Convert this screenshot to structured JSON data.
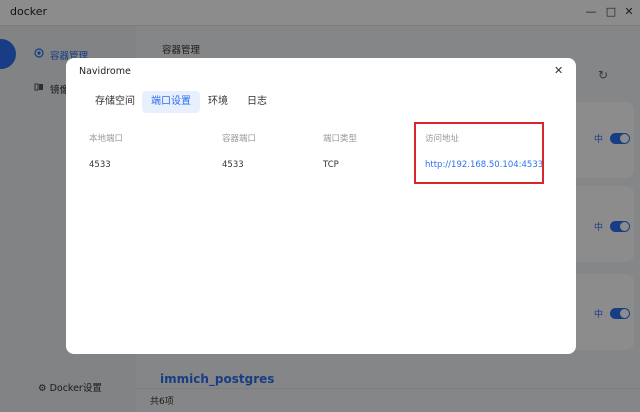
{
  "window": {
    "title": "docker"
  },
  "sidebar": {
    "items": [
      {
        "label": "容器管理"
      },
      {
        "label": "镜像"
      }
    ],
    "settings_label": "Docker设置"
  },
  "main": {
    "title": "容器管理",
    "run_status": "中",
    "bottom_app": "immich_postgres",
    "footer_count": "共6项"
  },
  "modal": {
    "title": "Navidrome",
    "tabs": [
      {
        "label": "存储空间"
      },
      {
        "label": "端口设置"
      },
      {
        "label": "环境"
      },
      {
        "label": "日志"
      }
    ],
    "columns": [
      "本地端口",
      "容器端口",
      "端口类型",
      "访问地址"
    ],
    "row": {
      "local_port": "4533",
      "container_port": "4533",
      "type": "TCP",
      "url": "http://192.168.50.104:4533"
    }
  },
  "colors": {
    "accent": "#2d6ff0",
    "highlight": "#d9262c"
  }
}
